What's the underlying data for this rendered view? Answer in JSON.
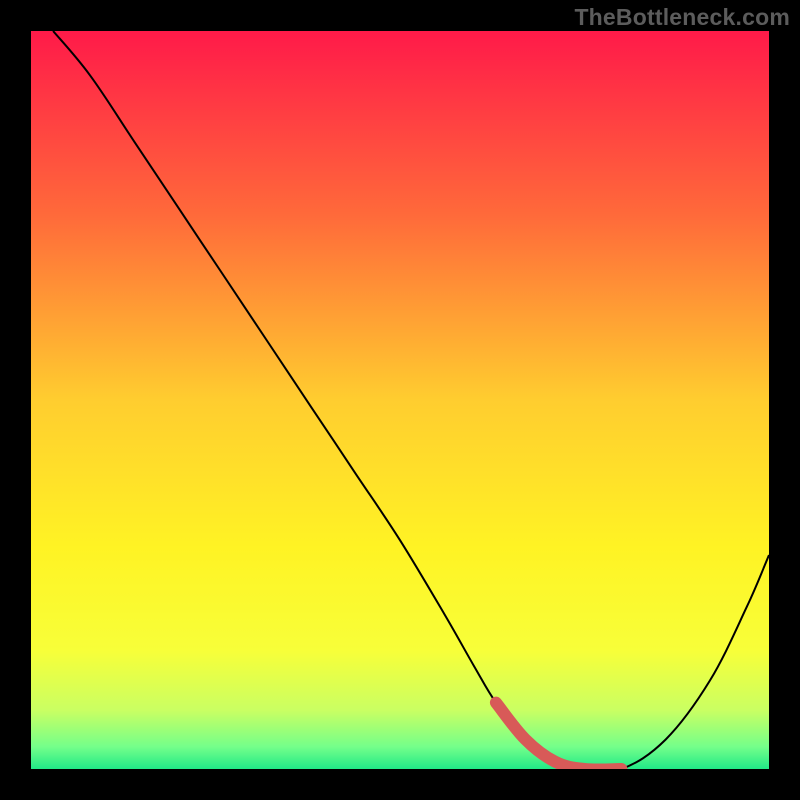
{
  "watermark": "TheBottleneck.com",
  "accent_color": "#d85a58",
  "curve_color": "#000000",
  "chart_data": {
    "type": "line",
    "title": "",
    "xlabel": "",
    "ylabel": "",
    "xlim": [
      0,
      100
    ],
    "ylim": [
      0,
      100
    ],
    "grid": false,
    "gradient_stops": [
      {
        "offset": 0.0,
        "color": "#ff1a49"
      },
      {
        "offset": 0.25,
        "color": "#ff6a3a"
      },
      {
        "offset": 0.5,
        "color": "#ffcd2f"
      },
      {
        "offset": 0.7,
        "color": "#fff324"
      },
      {
        "offset": 0.84,
        "color": "#f7ff39"
      },
      {
        "offset": 0.92,
        "color": "#caff62"
      },
      {
        "offset": 0.97,
        "color": "#74ff8a"
      },
      {
        "offset": 1.0,
        "color": "#21e987"
      }
    ],
    "series": [
      {
        "name": "bottleneck-curve",
        "x": [
          3,
          8,
          14,
          20,
          26,
          32,
          38,
          44,
          50,
          56,
          60,
          63,
          67,
          71,
          75,
          80,
          86,
          92,
          97,
          100
        ],
        "y": [
          100,
          94,
          85,
          76,
          67,
          58,
          49,
          40,
          31,
          21,
          14,
          9,
          4,
          1,
          0,
          0,
          4,
          12,
          22,
          29
        ]
      }
    ],
    "highlight_zone": {
      "name": "optimal-band",
      "x": [
        63,
        67,
        71,
        75,
        80
      ],
      "y": [
        9,
        4,
        1,
        0,
        0
      ]
    }
  }
}
